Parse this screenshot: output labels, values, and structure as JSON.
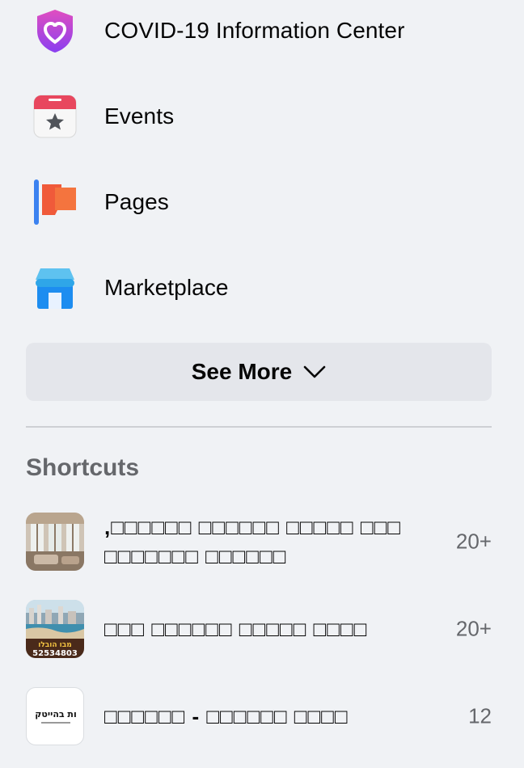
{
  "menu": {
    "items": [
      {
        "label": "COVID-19 Information Center",
        "icon": "covid-heart-shield-icon"
      },
      {
        "label": "Events",
        "icon": "calendar-star-icon"
      },
      {
        "label": "Pages",
        "icon": "flag-icon"
      },
      {
        "label": "Marketplace",
        "icon": "storefront-icon"
      }
    ],
    "see_more_label": "See More"
  },
  "shortcuts": {
    "title": "Shortcuts",
    "items": [
      {
        "name": ",□□□□□□ □□□□□□ □□□□□ □□□ □□□□□□□ □□□□□□",
        "count": "20+"
      },
      {
        "name": "□□□ □□□□□□ □□□□□ □□□□",
        "count": "20+"
      },
      {
        "name": "□□□□□□ - □□□□□□ □□□□",
        "count": "12"
      }
    ],
    "thumb_texts": [
      "מבו הובלו",
      "52534803",
      "ות בהייטק"
    ]
  },
  "colors": {
    "background": "#f0f2f5",
    "button_bg": "#e4e6eb",
    "secondary_text": "#65676b"
  }
}
